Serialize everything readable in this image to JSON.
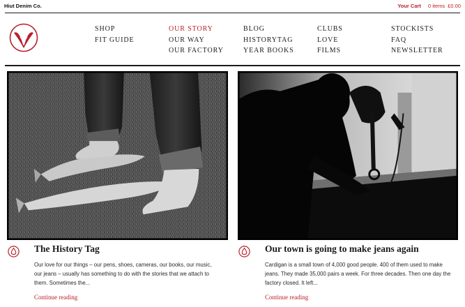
{
  "header": {
    "brand": "Hiut Denim Co.",
    "cart": {
      "title": "Your Cart",
      "items": "0 items",
      "total": "£0.00"
    }
  },
  "nav": {
    "columns": [
      [
        "SHOP",
        "FIT GUIDE"
      ],
      [
        "OUR STORY",
        "OUR WAY",
        "OUR FACTORY"
      ],
      [
        "BLOG",
        "HISTORYTAG",
        "YEAR BOOKS"
      ],
      [
        "CLUBS",
        "LOVE",
        "FILMS"
      ],
      [
        "STOCKISTS",
        "FAQ",
        "NEWSLETTER"
      ]
    ],
    "active": "OUR STORY"
  },
  "posts": [
    {
      "title": "The History Tag",
      "excerpt": "Our love for our things – our pens, shoes, cameras, our books, our music, our jeans – usually has something to do with the stories that we attach to them. Sometimes the...",
      "link": "Continue reading",
      "image_icon": "photo-barefoot-fish"
    },
    {
      "title": "Our town is going to make jeans again",
      "excerpt": "Cardigan is a small town of 4,000 good people. 400 of them used to make jeans. They made 35,000 pairs a week. For three decades. Then one day the factory closed. It left...",
      "link": "Continue reading",
      "image_icon": "photo-sewing-machine"
    }
  ],
  "colors": {
    "accent": "#b8202a",
    "text": "#1a1a1a"
  }
}
